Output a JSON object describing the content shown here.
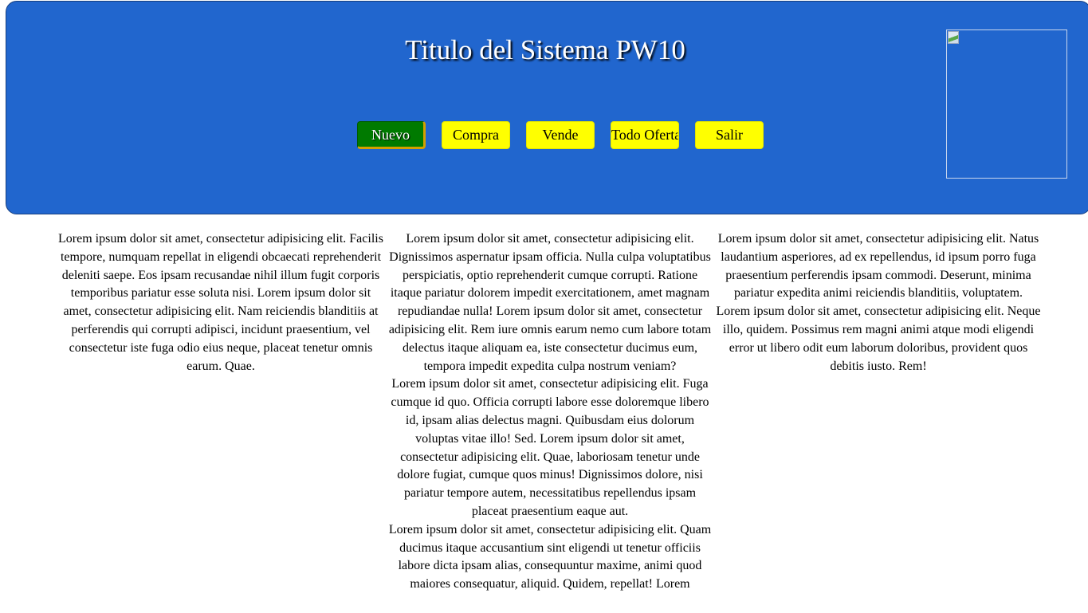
{
  "header": {
    "title": "Titulo del Sistema PW10",
    "colors": {
      "background": "#2166ce",
      "title_text": "#ffffff",
      "button": "#ffff00",
      "button_active": "#007a00"
    },
    "logo_icon": "broken-image-icon"
  },
  "nav": {
    "items": [
      {
        "label": "Nuevo",
        "active": true
      },
      {
        "label": "Compra",
        "active": false
      },
      {
        "label": "Vende",
        "active": false
      },
      {
        "label": "Todo Ofertas",
        "active": false
      },
      {
        "label": "Salir",
        "active": false
      }
    ]
  },
  "content": {
    "column1": [
      "Lorem ipsum dolor sit amet, consectetur adipisicing elit. Facilis tempore, numquam repellat in eligendi obcaecati reprehenderit deleniti saepe. Eos ipsam recusandae nihil illum fugit corporis temporibus pariatur esse soluta nisi. Lorem ipsum dolor sit amet, consectetur adipisicing elit. Nam reiciendis blanditiis at perferendis qui corrupti adipisci, incidunt praesentium, vel consectetur iste fuga odio eius neque, placeat tenetur omnis earum. Quae."
    ],
    "column2": [
      "Lorem ipsum dolor sit amet, consectetur adipisicing elit. Dignissimos aspernatur ipsam officia. Nulla culpa voluptatibus perspiciatis, optio reprehenderit cumque corrupti. Ratione itaque pariatur dolorem impedit exercitationem, amet magnam repudiandae nulla! Lorem ipsum dolor sit amet, consectetur adipisicing elit. Rem iure omnis earum nemo cum labore totam delectus itaque aliquam ea, iste consectetur ducimus eum, tempora impedit expedita culpa nostrum veniam?",
      "Lorem ipsum dolor sit amet, consectetur adipisicing elit. Fuga cumque id quo. Officia corrupti labore esse doloremque libero id, ipsam alias delectus magni. Quibusdam eius dolorum voluptas vitae illo! Sed. Lorem ipsum dolor sit amet, consectetur adipisicing elit. Quae, laboriosam tenetur unde dolore fugiat, cumque quos minus! Dignissimos dolore, nisi pariatur tempore autem, necessitatibus repellendus ipsam placeat praesentium eaque aut.",
      "Lorem ipsum dolor sit amet, consectetur adipisicing elit. Quam ducimus itaque accusantium sint eligendi ut tenetur officiis labore dicta ipsam alias, consequuntur maxime, animi quod maiores consequatur, aliquid. Quidem, repellat! Lorem"
    ],
    "column3": [
      "Lorem ipsum dolor sit amet, consectetur adipisicing elit. Natus laudantium asperiores, ad ex repellendus, id ipsum porro fuga praesentium perferendis ipsam commodi. Deserunt, minima pariatur expedita animi reiciendis blanditiis, voluptatem. Lorem ipsum dolor sit amet, consectetur adipisicing elit. Neque illo, quidem. Possimus rem magni animi atque modi eligendi error ut libero odit eum laborum doloribus, provident quos debitis iusto. Rem!"
    ]
  }
}
